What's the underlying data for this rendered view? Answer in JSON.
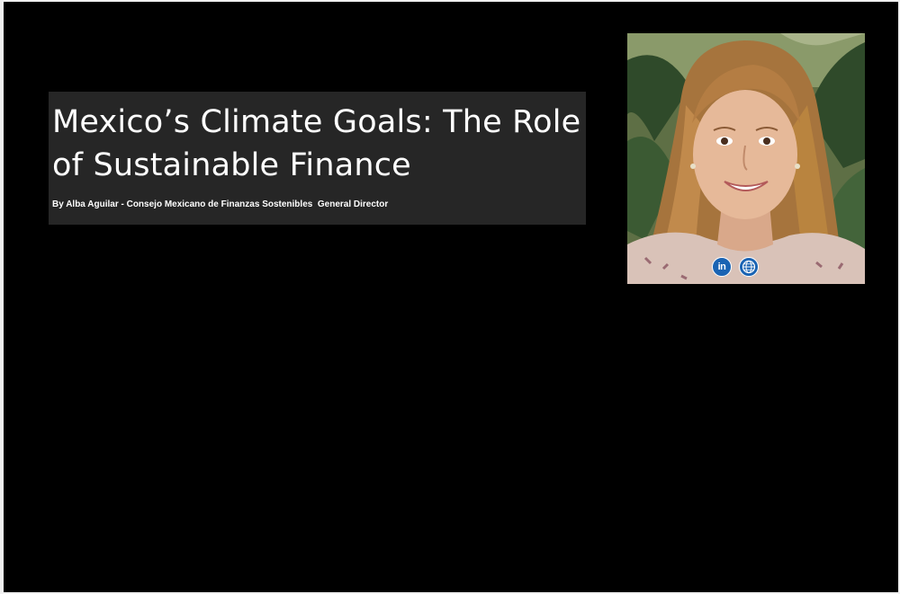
{
  "article": {
    "title": "Mexico’s Climate Goals: The Role of Sustainable Finance",
    "byline": "By Alba Aguilar - Consejo Mexicano de Finanzas Sostenibles  General Director"
  },
  "author_card": {
    "social_links": [
      {
        "icon": "linkedin-icon",
        "label": "in"
      },
      {
        "icon": "globe-icon"
      }
    ]
  },
  "colors": {
    "page_background": "#000000",
    "headline_box": "#262626",
    "text": "#ffffff",
    "social_icon_bg": "#1a63b3"
  }
}
